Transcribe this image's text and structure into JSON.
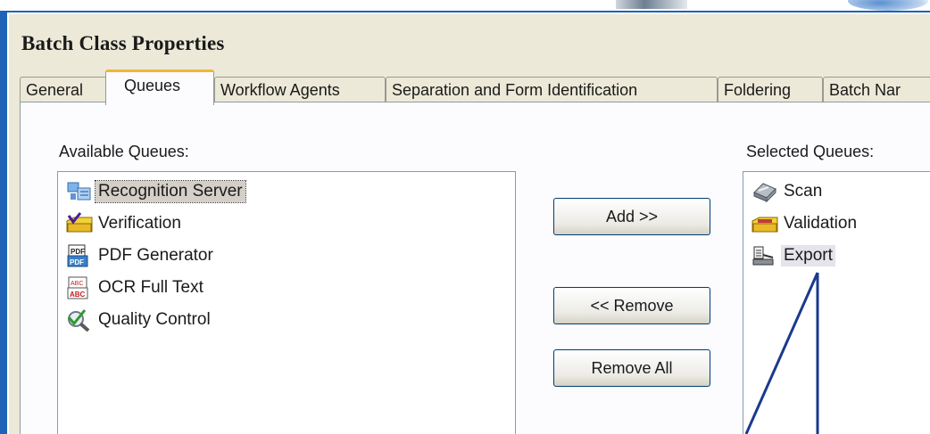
{
  "window": {
    "title": "Batch Class Properties"
  },
  "tabs": [
    {
      "label": "General",
      "active": false
    },
    {
      "label": "Queues",
      "active": true
    },
    {
      "label": "Workflow Agents",
      "active": false
    },
    {
      "label": "Separation and Form Identification",
      "active": false
    },
    {
      "label": "Foldering",
      "active": false
    },
    {
      "label": "Batch Nar",
      "active": false
    }
  ],
  "available": {
    "label": "Available Queues:",
    "items": [
      {
        "label": "Recognition Server",
        "icon": "recognition-server-icon",
        "selected": true
      },
      {
        "label": "Verification",
        "icon": "verification-icon",
        "selected": false
      },
      {
        "label": "PDF Generator",
        "icon": "pdf-generator-icon",
        "selected": false
      },
      {
        "label": "OCR Full Text",
        "icon": "ocr-full-text-icon",
        "selected": false
      },
      {
        "label": "Quality Control",
        "icon": "quality-control-icon",
        "selected": false
      }
    ]
  },
  "buttons": {
    "add": "Add >>",
    "remove": "<< Remove",
    "remove_all": "Remove All"
  },
  "selected": {
    "label": "Selected Queues:",
    "items": [
      {
        "label": "Scan",
        "icon": "scan-icon",
        "selected": false
      },
      {
        "label": "Validation",
        "icon": "validation-icon",
        "selected": false
      },
      {
        "label": "Export",
        "icon": "export-icon",
        "selected": true
      }
    ]
  },
  "colors": {
    "frame": "#1d63b8",
    "active_tab_accent": "#f4b33c",
    "callout_line": "#1b3a8c"
  }
}
